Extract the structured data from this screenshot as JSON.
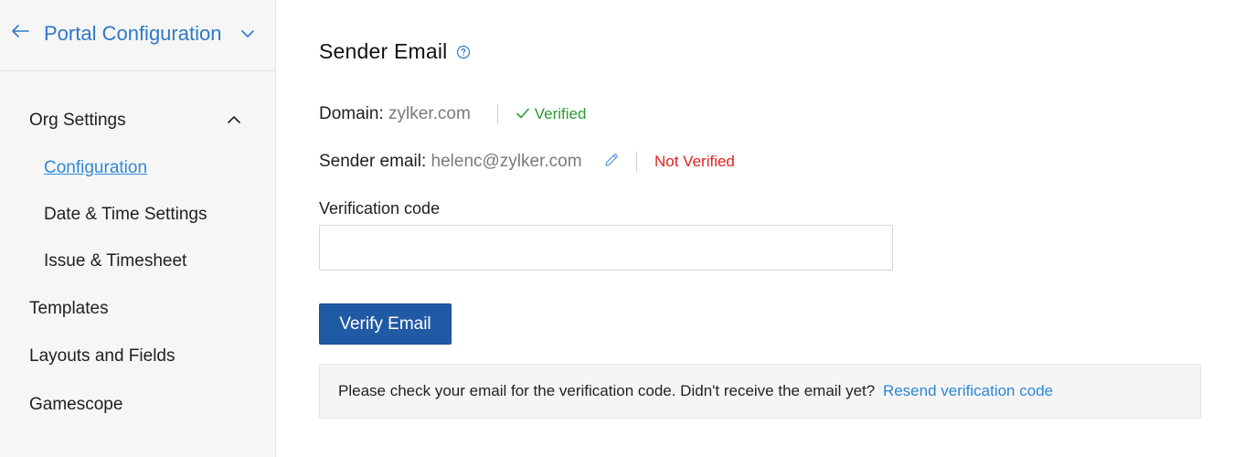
{
  "sidebar": {
    "title": "Portal Configuration",
    "section": {
      "label": "Org Settings",
      "items": [
        {
          "label": "Configuration",
          "active": true
        },
        {
          "label": "Date & Time Settings",
          "active": false
        },
        {
          "label": "Issue & Timesheet",
          "active": false
        }
      ]
    },
    "items": [
      {
        "label": "Templates"
      },
      {
        "label": "Layouts and Fields"
      },
      {
        "label": "Gamescope"
      }
    ]
  },
  "main": {
    "title": "Sender Email",
    "domain": {
      "label": "Domain:",
      "value": "zylker.com",
      "status": "Verified",
      "status_color": "#2c9a38"
    },
    "sender": {
      "label": "Sender email:",
      "value": "helenc@zylker.com",
      "status": "Not Verified",
      "status_color": "#e02222"
    },
    "verification": {
      "label": "Verification code",
      "value": "",
      "placeholder": ""
    },
    "verify_button": "Verify Email",
    "info": {
      "text": "Please check your email for the verification code. Didn't receive the email yet?",
      "link": "Resend verification code"
    }
  },
  "colors": {
    "accent": "#2f78c8",
    "link": "#2f86d6",
    "button": "#215aa4",
    "sidebar_bg": "#f6f6f6"
  },
  "icons": {
    "back": "arrow-left-icon",
    "title_toggle": "chevron-down-icon",
    "section_toggle": "chevron-up-icon",
    "help": "question-circle-icon",
    "edit": "pencil-icon",
    "verified": "check-icon"
  }
}
